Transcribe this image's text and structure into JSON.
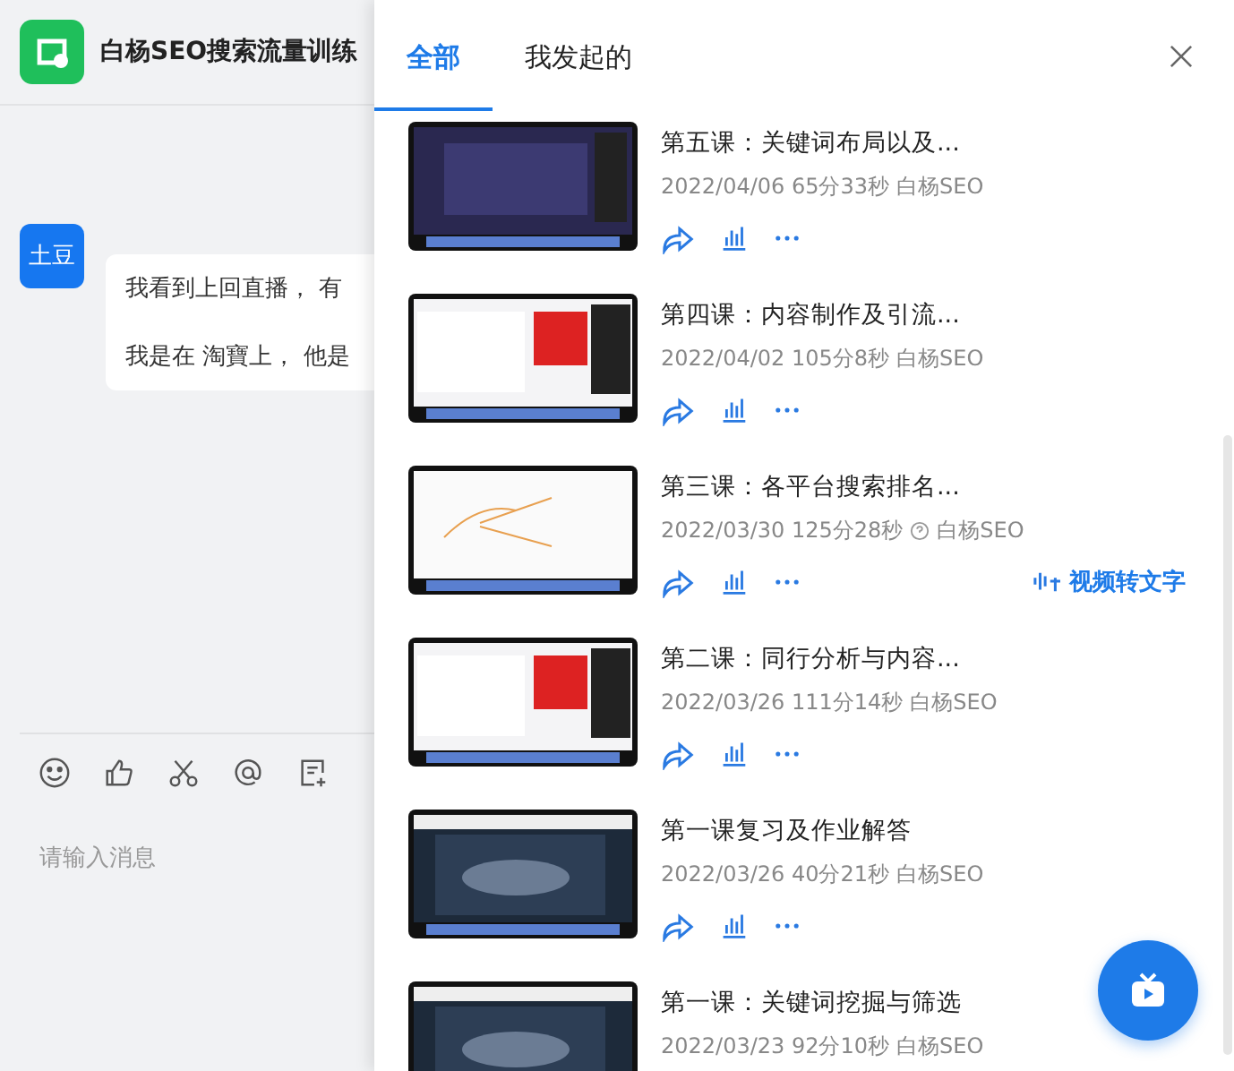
{
  "chat": {
    "title": "白杨SEO搜索流量训练",
    "messages": [
      {
        "avatar": "土豆",
        "lines": [
          "我看到上回直播， 有",
          "我是在 淘寶上， 他是"
        ]
      }
    ],
    "input": {
      "placeholder": "请输入消息"
    }
  },
  "panel": {
    "tabs": [
      {
        "label": "全部",
        "selected": true
      },
      {
        "label": "我发起的",
        "selected": false
      }
    ],
    "videos": [
      {
        "title": "第五课：关键词布局以及...",
        "date": "2022/04/06",
        "duration": "65分33秒",
        "author": "白杨SEO",
        "help_icon": false
      },
      {
        "title": "第四课：内容制作及引流...",
        "date": "2022/04/02",
        "duration": "105分8秒",
        "author": "白杨SEO",
        "help_icon": false
      },
      {
        "title": "第三课：各平台搜索排名...",
        "date": "2022/03/30",
        "duration": "125分28秒",
        "author": "白杨SEO",
        "help_icon": true,
        "transcribe": "视频转文字"
      },
      {
        "title": "第二课：同行分析与内容...",
        "date": "2022/03/26",
        "duration": "111分14秒",
        "author": "白杨SEO",
        "help_icon": false
      },
      {
        "title": "第一课复习及作业解答",
        "date": "2022/03/26",
        "duration": "40分21秒",
        "author": "白杨SEO",
        "help_icon": false
      },
      {
        "title": "第一课：关键词挖掘与筛选",
        "date": "2022/03/23",
        "duration": "92分10秒",
        "author": "白杨SEO",
        "help_icon": false
      }
    ]
  }
}
